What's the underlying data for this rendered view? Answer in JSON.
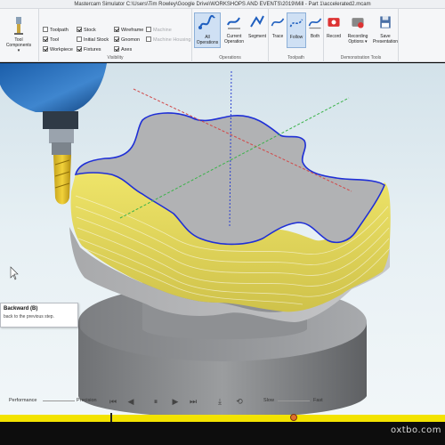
{
  "window": {
    "title": "Mastercam Simulator  C:\\Users\\Tim Rowley\\Google Drive\\WORKSHOPS AND EVENTS\\2019\\Mill - Part 1\\accelerated2.mcam"
  },
  "ribbon": {
    "tool_components": "Tool\nComponents ▾",
    "visibility": {
      "label": "Visibility",
      "checks": [
        {
          "label": "Toolpath",
          "checked": false,
          "disabled": false
        },
        {
          "label": "Tool",
          "checked": true,
          "disabled": false
        },
        {
          "label": "Workpiece",
          "checked": true,
          "disabled": false
        },
        {
          "label": "Stock",
          "checked": true,
          "disabled": false
        },
        {
          "label": "Initial Stock",
          "checked": false,
          "disabled": false
        },
        {
          "label": "Fixtures",
          "checked": true,
          "disabled": false
        },
        {
          "label": "Wireframe",
          "checked": true,
          "disabled": false
        },
        {
          "label": "Gnomon",
          "checked": true,
          "disabled": false
        },
        {
          "label": "Axes",
          "checked": true,
          "disabled": false
        },
        {
          "label": "Machine",
          "checked": false,
          "disabled": true
        },
        {
          "label": "Machine Housing",
          "checked": false,
          "disabled": true
        }
      ]
    },
    "operations": {
      "label": "Operations",
      "buttons": [
        {
          "label": "All\nOperations",
          "active": true
        },
        {
          "label": "Current\nOperation",
          "active": false
        },
        {
          "label": "Segment",
          "active": false
        }
      ]
    },
    "toolpath": {
      "label": "Toolpath",
      "buttons": [
        {
          "label": "Trace",
          "active": false
        },
        {
          "label": "Follow",
          "active": true
        },
        {
          "label": "Both",
          "active": false
        }
      ]
    },
    "demo_tools": {
      "label": "Demonstration Tools",
      "buttons": [
        {
          "label": "Record",
          "active": false
        },
        {
          "label": "Recording\nOptions ▾",
          "active": false
        },
        {
          "label": "Save\nPresentation",
          "active": false
        }
      ]
    }
  },
  "tooltip": {
    "title": "Backward (B)",
    "description": "back to the previous step."
  },
  "playback": {
    "performance": "Performance",
    "precision": "Precision",
    "slow": "Slow",
    "fast": "Fast"
  },
  "watermark": "oxtbo.com",
  "colors": {
    "stock_yellow": "#e6dc5a",
    "stock_gray": "#b9b9b9",
    "toolpath_blue": "#1f2fd6",
    "timeline_yellow": "#f3e300",
    "active_blue": "#cfe0f4"
  },
  "icons": [
    "tool-components-icon",
    "all-operations-icon",
    "current-operation-icon",
    "segment-icon",
    "trace-icon",
    "follow-icon",
    "both-icon",
    "record-icon",
    "recording-options-icon",
    "save-presentation-icon",
    "play-icon",
    "step-back-icon",
    "step-forward-icon"
  ]
}
